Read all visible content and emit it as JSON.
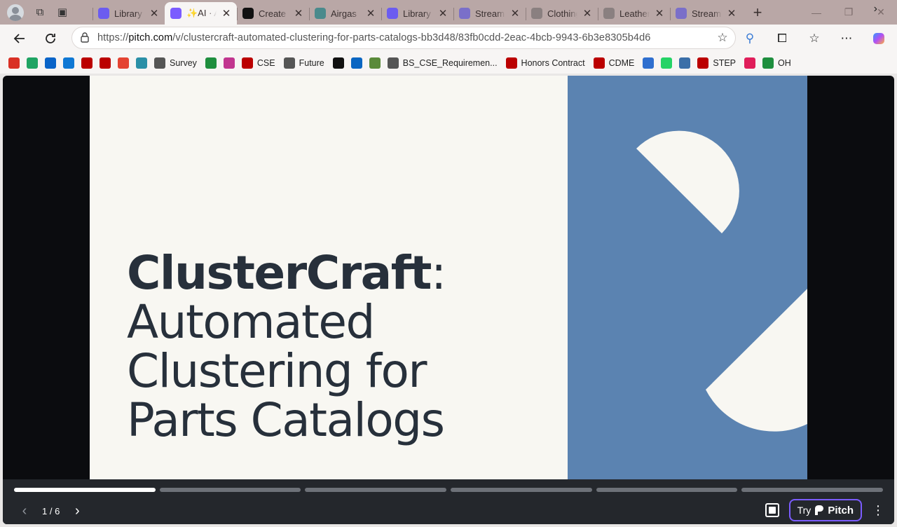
{
  "browser": {
    "tabs": [
      {
        "label": "Library",
        "favicon_color": "#6b5cf0",
        "active": false
      },
      {
        "label": "✨AI · AI",
        "favicon_color": "#7b5cff",
        "active": true
      },
      {
        "label": "Create N",
        "favicon_color": "#111111",
        "active": false
      },
      {
        "label": "Airgas",
        "favicon_color": "#4a8a8c",
        "active": false
      },
      {
        "label": "Library",
        "favicon_color": "#6b5cf0",
        "active": false
      },
      {
        "label": "Streaml",
        "favicon_color": "#7a6fc9",
        "active": false
      },
      {
        "label": "Clothing",
        "favicon_color": "#8a8080",
        "active": false
      },
      {
        "label": "Leather",
        "favicon_color": "#8a8080",
        "active": false
      },
      {
        "label": "Streaml",
        "favicon_color": "#7a6fc9",
        "active": false
      }
    ],
    "url_prefix": "https://",
    "url_host": "pitch.com",
    "url_path": "/v/clustercraft-automated-clustering-for-parts-catalogs-bb3d48/83fb0cdd-2eac-4bcb-9943-6b3e8305b4d6"
  },
  "bookmarks": [
    {
      "label": "",
      "icon": "gmail-icon",
      "color": "#d93025"
    },
    {
      "label": "",
      "icon": "drive-icon",
      "color": "#1fa463"
    },
    {
      "label": "",
      "icon": "outlook-icon",
      "color": "#0a64c8"
    },
    {
      "label": "",
      "icon": "onedrive-icon",
      "color": "#0f78d4"
    },
    {
      "label": "",
      "icon": "osu-icon",
      "color": "#bb0000"
    },
    {
      "label": "",
      "icon": "osu-icon",
      "color": "#bb0000"
    },
    {
      "label": "",
      "icon": "todoist-icon",
      "color": "#e44332"
    },
    {
      "label": "",
      "icon": "pitch-p-icon",
      "color": "#2a8fa7"
    },
    {
      "label": "Survey",
      "icon": "globe-icon",
      "color": "#555555"
    },
    {
      "label": "",
      "icon": "sheets-icon",
      "color": "#1e8e3e"
    },
    {
      "label": "",
      "icon": "instagram-icon",
      "color": "#c1358f"
    },
    {
      "label": "CSE",
      "icon": "osu-icon",
      "color": "#bb0000"
    },
    {
      "label": "Future",
      "icon": "folder-icon",
      "color": "#555555"
    },
    {
      "label": "",
      "icon": "github-icon",
      "color": "#111111"
    },
    {
      "label": "",
      "icon": "linkedin-icon",
      "color": "#0a66c2"
    },
    {
      "label": "",
      "icon": "apps-icon",
      "color": "#5a8a3a"
    },
    {
      "label": "BS_CSE_Requiremen...",
      "icon": "globe-icon",
      "color": "#555555"
    },
    {
      "label": "Honors Contract",
      "icon": "osu-small-icon",
      "color": "#bb0000"
    },
    {
      "label": "CDME",
      "icon": "osu-icon",
      "color": "#bb0000"
    },
    {
      "label": "",
      "icon": "zotero-icon",
      "color": "#2f6fcf"
    },
    {
      "label": "",
      "icon": "whatsapp-icon",
      "color": "#25d366"
    },
    {
      "label": "",
      "icon": "p-icon",
      "color": "#3b6fa8"
    },
    {
      "label": "STEP",
      "icon": "osu-icon",
      "color": "#bb0000"
    },
    {
      "label": "",
      "icon": "slack-icon",
      "color": "#e01e5a"
    },
    {
      "label": "OH",
      "icon": "sheets-icon",
      "color": "#1e8e3e"
    }
  ],
  "slide": {
    "title_bold": "ClusterCraft",
    "title_colon": ":",
    "title_lines": [
      "Automated",
      "Clustering for",
      "Parts Catalogs"
    ],
    "accent_color": "#5b83b1"
  },
  "player": {
    "page_indicator": "1 / 6",
    "total_slides": 6,
    "current_slide": 1,
    "try_label": "Try",
    "brand_label": "Pitch"
  }
}
